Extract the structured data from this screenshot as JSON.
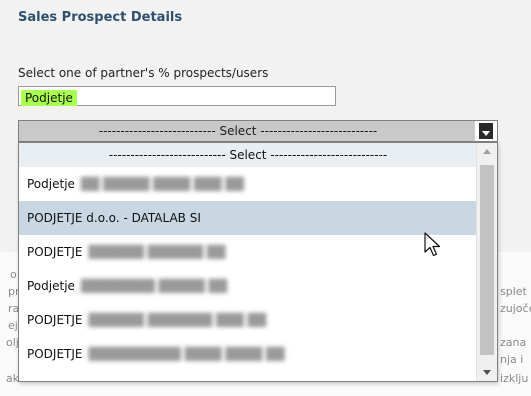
{
  "form": {
    "title": "Sales Prospect Details",
    "instruction": "Select one of partner's % prospects/users",
    "input_value": "Podjetje"
  },
  "select": {
    "label": "--------------------------- Select ---------------------------"
  },
  "dropdown": {
    "header": "--------------------------- Select ---------------------------",
    "options": [
      {
        "label": "Podjetje",
        "detail": "██ █████ ████ ███ ██"
      },
      {
        "label": "PODJETJE d.o.o. - DATALAB SI",
        "detail": ""
      },
      {
        "label": "PODJETJE",
        "detail": "██████ ██████ ██"
      },
      {
        "label": "Podjetje",
        "detail": "████████ █████ ██"
      },
      {
        "label": "PODJETJE",
        "detail": "██████ ███████ ███ ██"
      },
      {
        "label": "PODJETJE",
        "detail": "██████████ ████ ████ ██"
      }
    ]
  },
  "background": {
    "snippets": [
      "o",
      "pr",
      "ra",
      "ej",
      "olj",
      "ak",
      "splet",
      "zujoče",
      "zana",
      "nja i",
      "izklju"
    ]
  },
  "colors": {
    "title": "#2f4f6f",
    "input_highlight": "#a9ff4f",
    "hover_row": "#c9d7e2",
    "select_bg": "#c9c9c9"
  }
}
